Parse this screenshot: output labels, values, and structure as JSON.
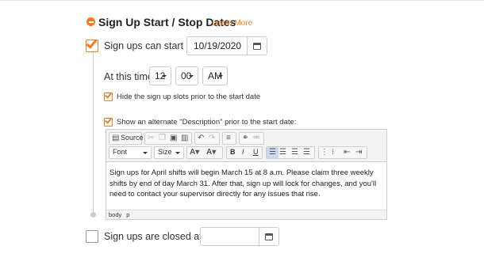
{
  "section": {
    "title": "Sign Up Start / Stop Dates",
    "learn_more": "Learn More"
  },
  "start": {
    "checked": true,
    "label": "Sign ups can start on:",
    "date_value": "10/19/2020",
    "time_label": "At this time:",
    "hour": "12",
    "minute": "00",
    "ampm": "AM",
    "hide_slots": {
      "checked": true,
      "label": "Hide the sign up slots prior to the start date"
    },
    "alt_desc": {
      "checked": true,
      "label": "Show an alternate \"Description\" prior to the start date:"
    }
  },
  "editor": {
    "source_label": "Source",
    "font_label": "Font",
    "size_label": "Size",
    "bold": "B",
    "italic": "I",
    "underline": "U",
    "content": "Sign ups for April shifts will begin March 15 at 8 a.m. Please claim three weekly shifts by end of day March 31. After that, sign up will lock for changes, and you'll need to contact your supervisor directly for any issues that rise.",
    "path": [
      "body",
      "p"
    ]
  },
  "close": {
    "checked": false,
    "label": "Sign ups are closed after:",
    "date_value": ""
  },
  "colors": {
    "accent": "#f47a20"
  },
  "icons": [
    "minus-circle-icon",
    "checkmark-icon",
    "calendar-icon",
    "caret-down-icon",
    "source-icon",
    "cut-icon",
    "copy-icon",
    "paste-icon",
    "undo-icon",
    "redo-icon",
    "link-icon",
    "unlink-icon",
    "align-left-icon",
    "align-center-icon",
    "align-right-icon",
    "justify-icon",
    "numbered-list-icon",
    "bulleted-list-icon",
    "indent-icon",
    "outdent-icon"
  ]
}
